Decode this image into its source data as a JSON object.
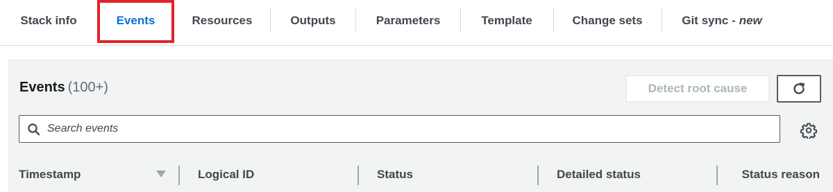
{
  "tabs": [
    {
      "label": "Stack info",
      "active": false
    },
    {
      "label": "Events",
      "active": true
    },
    {
      "label": "Resources",
      "active": false
    },
    {
      "label": "Outputs",
      "active": false
    },
    {
      "label": "Parameters",
      "active": false
    },
    {
      "label": "Template",
      "active": false
    },
    {
      "label": "Change sets",
      "active": false
    },
    {
      "label": "Git sync -",
      "suffix": "new",
      "active": false
    }
  ],
  "events_panel": {
    "title": "Events",
    "count": "(100+)",
    "detect_button": "Detect root cause",
    "refresh_icon": "refresh-icon",
    "settings_icon": "gear-icon",
    "search": {
      "placeholder": "Search events",
      "value": "",
      "icon": "search-icon"
    },
    "columns": [
      "Timestamp",
      "Logical ID",
      "Status",
      "Detailed status",
      "Status reason"
    ],
    "sort_icon": "sort-down-icon"
  },
  "colors": {
    "active_tab": "#0972d3",
    "highlight": "#e2232a",
    "panel_bg": "#f2f3f3",
    "disabled_text": "#aab7b8"
  }
}
